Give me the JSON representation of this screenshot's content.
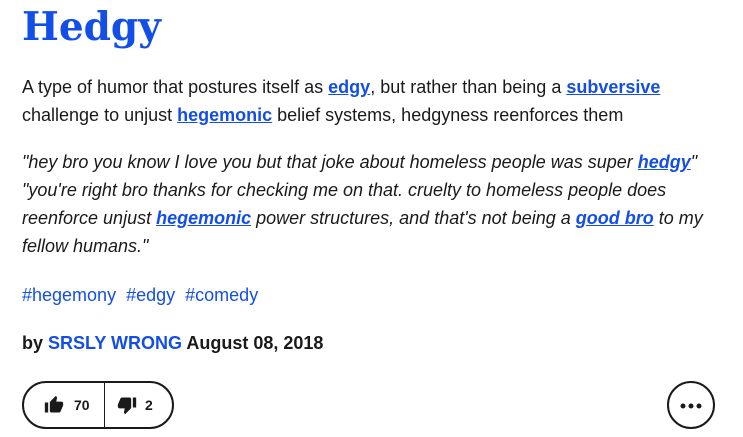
{
  "word": "Hedgy",
  "meaning": {
    "t1": "A type of humor that postures itself as ",
    "l1": "edgy",
    "t2": ", but rather than being a ",
    "l2": "subversive",
    "t3": " challenge to unjust ",
    "l3": "hegemonic",
    "t4": " belief systems, hedgyness reenforces them"
  },
  "example": {
    "t1": "\"hey bro you know I love you but that joke about homeless people was super ",
    "l1": "hedgy",
    "t2": "\"",
    "t3": "\"you're right bro thanks for checking me on that. cruelty to homeless people does reenforce unjust ",
    "l2": "hegemonic",
    "t4": " power structures, and that's not being a ",
    "l3": "good bro",
    "t5": " to my fellow humans.\""
  },
  "tags": [
    "#hegemony",
    "#edgy",
    "#comedy"
  ],
  "byline": {
    "prefix": "by ",
    "author": "SRSLY WRONG",
    "date": " August 08, 2018"
  },
  "votes": {
    "up_count": "70",
    "down_count": "2"
  },
  "icons": {
    "upvote": "thumbs-up-icon",
    "downvote": "thumbs-down-icon",
    "more": "more-options-icon"
  },
  "colors": {
    "link": "#134fe6",
    "text": "#1a1a1a"
  }
}
